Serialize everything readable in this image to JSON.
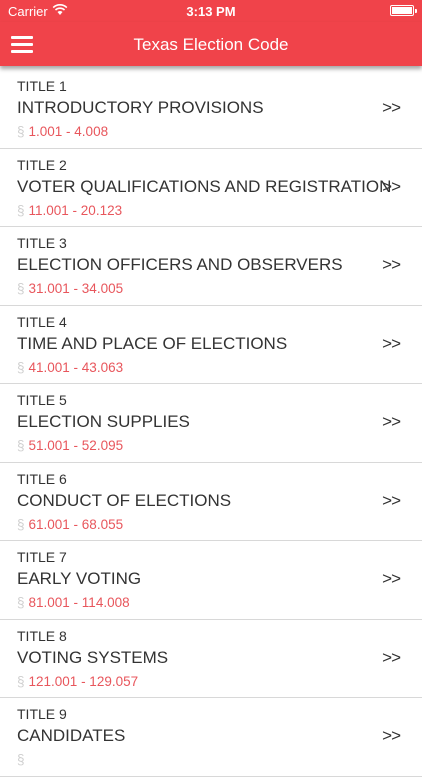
{
  "status_bar": {
    "carrier": "Carrier",
    "time": "3:13 PM",
    "battery_level": 1.0
  },
  "nav": {
    "title": "Texas Election Code",
    "menu_icon": "hamburger-icon"
  },
  "colors": {
    "accent": "#f0434a",
    "range_text": "#e8565c"
  },
  "titles": [
    {
      "label": "TITLE 1",
      "name": "INTRODUCTORY PROVISIONS",
      "section_symbol": "§",
      "range": "1.001 - 4.008",
      "chevron": ">>"
    },
    {
      "label": "TITLE 2",
      "name": "VOTER QUALIFICATIONS AND REGISTRATION",
      "section_symbol": "§",
      "range": "11.001 - 20.123",
      "chevron": ">>"
    },
    {
      "label": "TITLE 3",
      "name": "ELECTION OFFICERS AND OBSERVERS",
      "section_symbol": "§",
      "range": "31.001 - 34.005",
      "chevron": ">>"
    },
    {
      "label": "TITLE 4",
      "name": "TIME AND PLACE OF ELECTIONS",
      "section_symbol": "§",
      "range": "41.001 - 43.063",
      "chevron": ">>"
    },
    {
      "label": "TITLE 5",
      "name": "ELECTION SUPPLIES",
      "section_symbol": "§",
      "range": "51.001 - 52.095",
      "chevron": ">>"
    },
    {
      "label": "TITLE 6",
      "name": "CONDUCT OF ELECTIONS",
      "section_symbol": "§",
      "range": "61.001 - 68.055",
      "chevron": ">>"
    },
    {
      "label": "TITLE 7",
      "name": "EARLY VOTING",
      "section_symbol": "§",
      "range": "81.001 - 114.008",
      "chevron": ">>"
    },
    {
      "label": "TITLE 8",
      "name": "VOTING SYSTEMS",
      "section_symbol": "§",
      "range": "121.001 - 129.057",
      "chevron": ">>"
    },
    {
      "label": "TITLE 9",
      "name": "CANDIDATES",
      "section_symbol": "§",
      "range": "",
      "chevron": ">>"
    }
  ]
}
